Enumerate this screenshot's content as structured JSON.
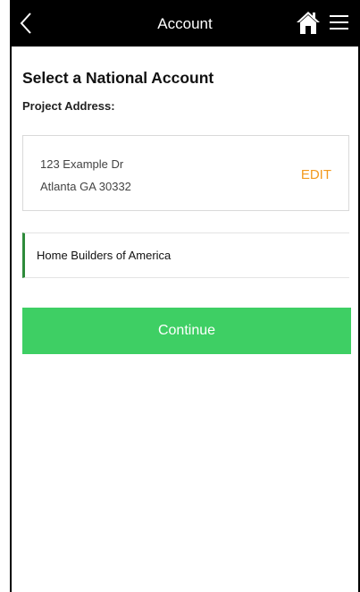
{
  "header": {
    "title": "Account",
    "back_icon": "chevron-left-icon",
    "home_icon": "home-icon",
    "menu_icon": "hamburger-menu-icon"
  },
  "main": {
    "heading": "Select a National Account",
    "subheading": "Project Address:",
    "address": {
      "line1": "123 Example Dr",
      "line2": "Atlanta GA 30332",
      "edit_label": "EDIT"
    },
    "accounts": [
      {
        "name": "Home Builders of America"
      }
    ],
    "continue_label": "Continue"
  },
  "colors": {
    "header_bg": "#000000",
    "accent_orange": "#f39a1e",
    "button_green": "#3ecf64",
    "selected_bar": "#2e8b3a"
  }
}
